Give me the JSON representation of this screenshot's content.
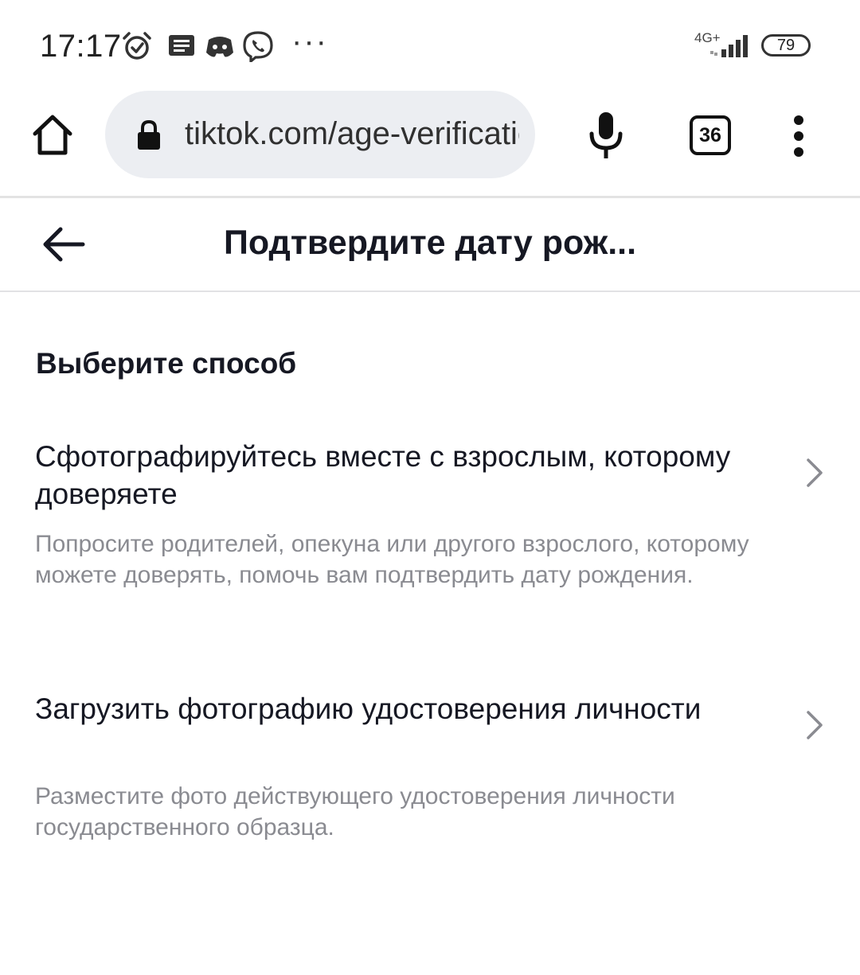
{
  "status_bar": {
    "time": "17:17",
    "network": "4G+",
    "battery": "79",
    "icons": [
      "alarm-icon",
      "message-icon",
      "discord-icon",
      "viber-icon",
      "more-notifications-icon",
      "signal-icon",
      "battery-icon"
    ]
  },
  "browser": {
    "url": "tiktok.com/age-verification",
    "tab_count": "36",
    "icons": [
      "home-icon",
      "lock-icon",
      "mic-icon",
      "tabs-icon",
      "overflow-menu-icon"
    ]
  },
  "header": {
    "title": "Подтвердите дату рож..."
  },
  "main": {
    "section_title": "Выберите способ",
    "options": [
      {
        "title": "Сфотографируйтесь вместе с взрослым, которому доверяете",
        "description": "Попросите родителей, опекуна или другого взрослого, которому можете доверять, помочь вам подтвердить дату рождения."
      },
      {
        "title": "Загрузить фотографию удостоверения личности",
        "description": "Разместите фото действующего удостоверения личности государственного образца."
      }
    ]
  },
  "colors": {
    "text_primary": "#161823",
    "text_secondary": "#8a8b91",
    "url_bar_bg": "#eceef2",
    "divider": "#e2e2e4"
  }
}
